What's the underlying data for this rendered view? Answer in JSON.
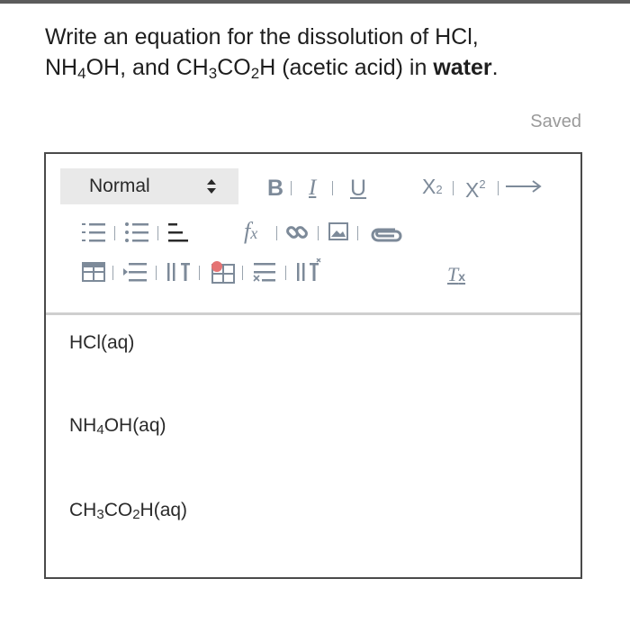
{
  "question": {
    "part1": "Write an equation for the dissolution of HCl,",
    "nh": "NH",
    "sub4": "4",
    "oh_and_ch": "OH, and CH",
    "sub3": "3",
    "co": "CO",
    "sub2": "2",
    "h_acetic": "H (acetic acid) in ",
    "water": "water",
    "period": "."
  },
  "status": {
    "saved": "Saved"
  },
  "toolbar": {
    "format_value": "Normal",
    "bold": "B",
    "italic": "I",
    "underline": "U",
    "subscript_base": "X",
    "subscript_mark": "2",
    "superscript_base": "X",
    "superscript_mark": "2",
    "formula_f": "f",
    "formula_x": "x",
    "clear_t": "T",
    "clear_x": "x",
    "icons": [
      "format-select",
      "bold-icon",
      "italic-icon",
      "underline-icon",
      "subscript-icon",
      "superscript-icon",
      "arrow-icon",
      "numbered-list-icon",
      "bullet-list-icon",
      "align-icon",
      "formula-icon",
      "link-icon",
      "image-icon",
      "attachment-icon",
      "insert-table-icon",
      "insert-row-icon",
      "insert-column-icon",
      "delete-table-icon",
      "delete-row-icon",
      "delete-column-icon",
      "clear-formatting-icon"
    ]
  },
  "content": {
    "line1": "HCl(aq)",
    "line2_a": "NH",
    "line2_sub": "4",
    "line2_b": "OH(aq)",
    "line3_a": "CH",
    "line3_sub1": "3",
    "line3_b": "CO",
    "line3_sub2": "2",
    "line3_c": "H(aq)"
  },
  "colors": {
    "icon": "#7d8a99",
    "border": "#4a4a4a",
    "select_bg": "#e9e9e9",
    "saved": "#9a9a9a",
    "delete_accent": "#e57373"
  }
}
